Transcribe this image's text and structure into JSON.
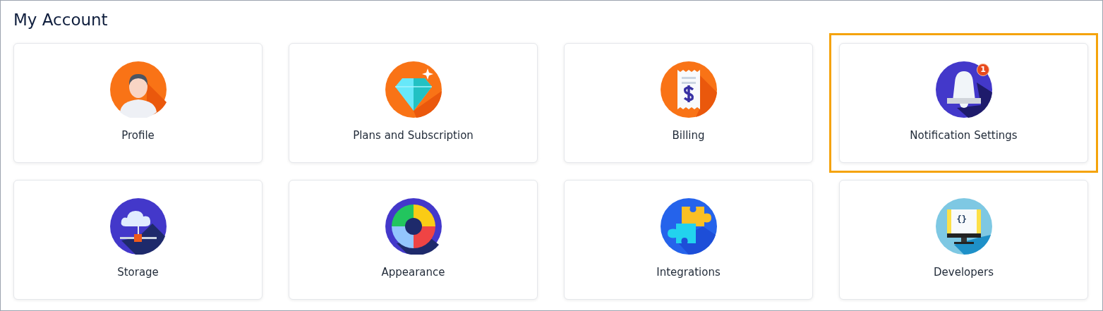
{
  "title": "My Account",
  "cards": [
    {
      "label": "Profile",
      "kind": "person",
      "selected": false
    },
    {
      "label": "Plans and Subscription",
      "kind": "diamond",
      "selected": false
    },
    {
      "label": "Billing",
      "kind": "receipt",
      "selected": false
    },
    {
      "label": "Notification Settings",
      "kind": "bell",
      "badge": "1",
      "selected": true
    },
    {
      "label": "Storage",
      "kind": "cloud",
      "selected": false
    },
    {
      "label": "Appearance",
      "kind": "palette",
      "selected": false
    },
    {
      "label": "Integrations",
      "kind": "puzzle",
      "selected": false
    },
    {
      "label": "Developers",
      "kind": "monitor",
      "screen_text": "{}",
      "selected": false
    }
  ]
}
